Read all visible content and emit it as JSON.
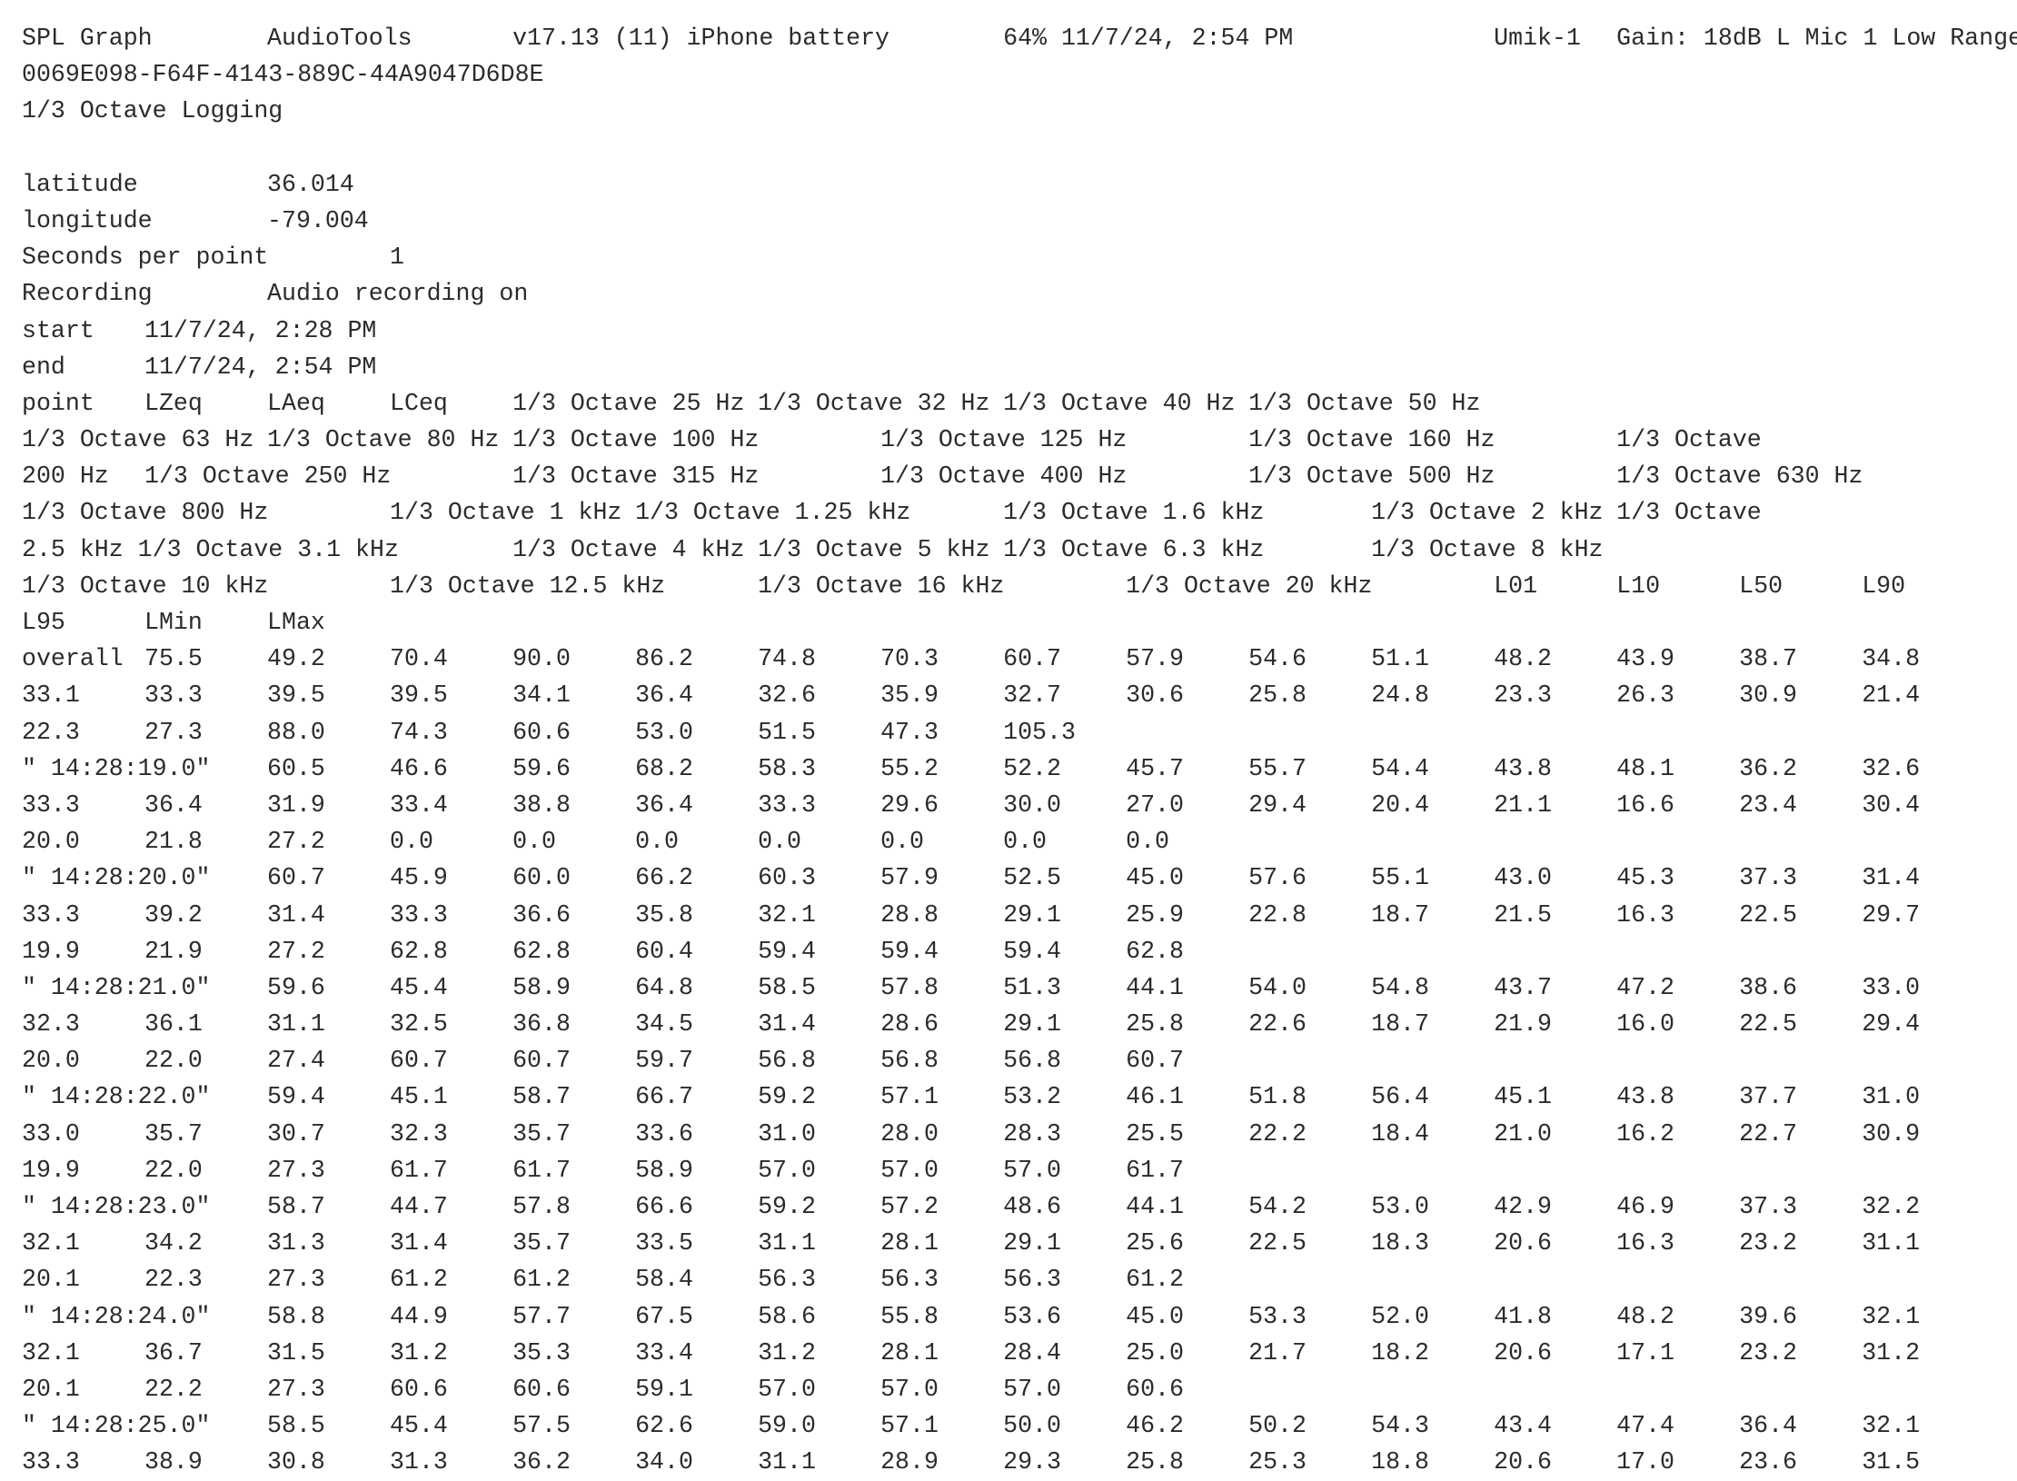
{
  "lines": [
    "SPL Graph\tAudioTools\tv17.13 (11) iPhone battery\t64% 11/7/24, 2:54 PM\t\tUmik-1\tGain: 18dB L Mic 1 Low Range",
    "0069E098-F64F-4143-889C-44A9047D6D8E",
    "1/3 Octave Logging",
    "",
    "latitude\t36.014",
    "longitude\t-79.004",
    "Seconds per point\t1",
    "Recording\tAudio recording on",
    "start\t11/7/24, 2:28 PM",
    "end\t11/7/24, 2:54 PM",
    "point\tLZeq\tLAeq\tLCeq\t1/3 Octave 25 Hz\t1/3 Octave 32 Hz\t1/3 Octave 40 Hz\t1/3 Octave 50 Hz",
    "1/3 Octave 63 Hz\t1/3 Octave 80 Hz\t1/3 Octave 100 Hz\t1/3 Octave 125 Hz\t1/3 Octave 160 Hz\t1/3 Octave",
    "200 Hz\t1/3 Octave 250 Hz\t1/3 Octave 315 Hz\t1/3 Octave 400 Hz\t1/3 Octave 500 Hz\t1/3 Octave 630 Hz",
    "1/3 Octave 800 Hz\t1/3 Octave 1 kHz\t1/3 Octave 1.25 kHz\t1/3 Octave 1.6 kHz\t1/3 Octave 2 kHz\t1/3 Octave",
    "2.5 kHz 1/3 Octave 3.1 kHz\t1/3 Octave 4 kHz\t1/3 Octave 5 kHz\t1/3 Octave 6.3 kHz\t1/3 Octave 8 kHz",
    "1/3 Octave 10 kHz\t1/3 Octave 12.5 kHz\t1/3 Octave 16 kHz\t1/3 Octave 20 kHz\tL01\tL10\tL50\tL90",
    "L95\tLMin\tLMax",
    "overall\t75.5\t49.2\t70.4\t90.0\t86.2\t74.8\t70.3\t60.7\t57.9\t54.6\t51.1\t48.2\t43.9\t38.7\t34.8",
    "33.1\t33.3\t39.5\t39.5\t34.1\t36.4\t32.6\t35.9\t32.7\t30.6\t25.8\t24.8\t23.3\t26.3\t30.9\t21.4",
    "22.3\t27.3\t88.0\t74.3\t60.6\t53.0\t51.5\t47.3\t105.3",
    "\" 14:28:19.0\"\t60.5\t46.6\t59.6\t68.2\t58.3\t55.2\t52.2\t45.7\t55.7\t54.4\t43.8\t48.1\t36.2\t32.6",
    "33.3\t36.4\t31.9\t33.4\t38.8\t36.4\t33.3\t29.6\t30.0\t27.0\t29.4\t20.4\t21.1\t16.6\t23.4\t30.4",
    "20.0\t21.8\t27.2\t0.0\t0.0\t0.0\t0.0\t0.0\t0.0\t0.0",
    "\" 14:28:20.0\"\t60.7\t45.9\t60.0\t66.2\t60.3\t57.9\t52.5\t45.0\t57.6\t55.1\t43.0\t45.3\t37.3\t31.4",
    "33.3\t39.2\t31.4\t33.3\t36.6\t35.8\t32.1\t28.8\t29.1\t25.9\t22.8\t18.7\t21.5\t16.3\t22.5\t29.7",
    "19.9\t21.9\t27.2\t62.8\t62.8\t60.4\t59.4\t59.4\t59.4\t62.8",
    "\" 14:28:21.0\"\t59.6\t45.4\t58.9\t64.8\t58.5\t57.8\t51.3\t44.1\t54.0\t54.8\t43.7\t47.2\t38.6\t33.0",
    "32.3\t36.1\t31.1\t32.5\t36.8\t34.5\t31.4\t28.6\t29.1\t25.8\t22.6\t18.7\t21.9\t16.0\t22.5\t29.4",
    "20.0\t22.0\t27.4\t60.7\t60.7\t59.7\t56.8\t56.8\t56.8\t60.7",
    "\" 14:28:22.0\"\t59.4\t45.1\t58.7\t66.7\t59.2\t57.1\t53.2\t46.1\t51.8\t56.4\t45.1\t43.8\t37.7\t31.0",
    "33.0\t35.7\t30.7\t32.3\t35.7\t33.6\t31.0\t28.0\t28.3\t25.5\t22.2\t18.4\t21.0\t16.2\t22.7\t30.9",
    "19.9\t22.0\t27.3\t61.7\t61.7\t58.9\t57.0\t57.0\t57.0\t61.7",
    "\" 14:28:23.0\"\t58.7\t44.7\t57.8\t66.6\t59.2\t57.2\t48.6\t44.1\t54.2\t53.0\t42.9\t46.9\t37.3\t32.2",
    "32.1\t34.2\t31.3\t31.4\t35.7\t33.5\t31.1\t28.1\t29.1\t25.6\t22.5\t18.3\t20.6\t16.3\t23.2\t31.1",
    "20.1\t22.3\t27.3\t61.2\t61.2\t58.4\t56.3\t56.3\t56.3\t61.2",
    "\" 14:28:24.0\"\t58.8\t44.9\t57.7\t67.5\t58.6\t55.8\t53.6\t45.0\t53.3\t52.0\t41.8\t48.2\t39.6\t32.1",
    "32.1\t36.7\t31.5\t31.2\t35.3\t33.4\t31.2\t28.1\t28.4\t25.0\t21.7\t18.2\t20.6\t17.1\t23.2\t31.2",
    "20.1\t22.2\t27.3\t60.6\t60.6\t59.1\t57.0\t57.0\t57.0\t60.6",
    "\" 14:28:25.0\"\t58.5\t45.4\t57.5\t62.6\t59.0\t57.1\t50.0\t46.2\t50.2\t54.3\t43.4\t47.4\t36.4\t32.1",
    "33.3\t38.9\t30.8\t31.3\t36.2\t34.0\t31.1\t28.9\t29.3\t25.8\t25.3\t18.8\t20.6\t17.0\t23.6\t31.5"
  ]
}
